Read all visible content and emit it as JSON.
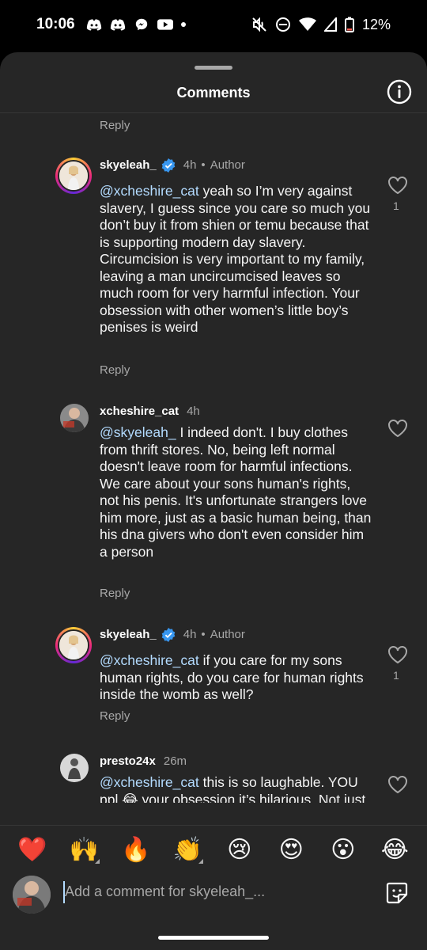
{
  "status_bar": {
    "time": "10:06",
    "battery": "12%",
    "left_icons": [
      "discord-icon",
      "discord-icon",
      "messenger-icon",
      "youtube-icon"
    ],
    "right_icons": [
      "mute-icon",
      "dnd-icon",
      "wifi-icon",
      "signal-icon",
      "battery-icon"
    ]
  },
  "sheet": {
    "title": "Comments",
    "info_icon": "info-icon"
  },
  "reply_label": "Reply",
  "comments": [
    {
      "username": "skyeleah_",
      "verified": true,
      "time": "4h",
      "author_label": "Author",
      "mention": "@xcheshire_cat",
      "text_line1": " yeah so I’m very against",
      "text_rest": "slavery, I guess since you care so much you don’t buy it from shien or temu because that is supporting modern day slavery.",
      "text_para2": "Circumcision is very important to my family, leaving a man uncircumcised leaves so much room for very harmful infection. Your obsession with other women’s little boy’s penises is weird",
      "likes": "1"
    },
    {
      "username": "xcheshire_cat",
      "time": "4h",
      "mention": "@skyeleah_",
      "text": " I indeed don't. I buy clothes from thrift stores. No, being left normal doesn't leave room for harmful infections. We care about your sons human's rights, not his penis. It's unfortunate strangers love him more, just as a basic human being, than his dna givers who don't even consider him a person"
    },
    {
      "username": "skyeleah_",
      "verified": true,
      "time": "4h",
      "author_label": "Author",
      "mention": "@xcheshire_cat",
      "text": " if you care for my sons human rights, do you care for human rights inside the womb as well?",
      "likes": "1"
    },
    {
      "username": "presto24x",
      "time": "26m",
      "mention": "@xcheshire_cat",
      "text": " this is so laughable. YOU ppl 😂 your obsession it’s hilarious. Not just you but the women who are"
    }
  ],
  "emoji_bar": [
    "❤️",
    "🙌",
    "🔥",
    "👏",
    "😢",
    "😍",
    "😮",
    "😂"
  ],
  "composer": {
    "placeholder": "Add a comment for skyeleah_...",
    "sticker_icon": "sticker-icon"
  }
}
